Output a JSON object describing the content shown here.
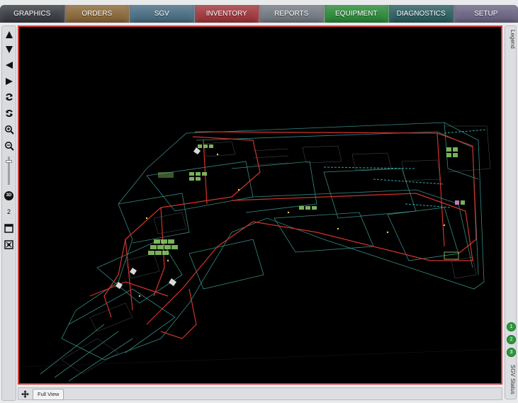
{
  "tabs": [
    {
      "label": "GRAPHICS",
      "color": "#3c3f46"
    },
    {
      "label": "ORDERS",
      "color": "#8a6a3c"
    },
    {
      "label": "SGV",
      "color": "#4d6f84"
    },
    {
      "label": "INVENTORY",
      "color": "#a13a3f"
    },
    {
      "label": "REPORTS",
      "color": "#767b84"
    },
    {
      "label": "EQUIPMENT",
      "color": "#2f8a3c"
    },
    {
      "label": "DIAGNOSTICS",
      "color": "#2f5f63"
    },
    {
      "label": "SETUP",
      "color": "#6d6784"
    }
  ],
  "toolbar": {
    "tools": [
      "pan-up-icon",
      "pan-down-icon",
      "pan-left-icon",
      "pan-right-icon",
      "rotate-cw-icon",
      "rotate-ccw-icon",
      "zoom-in-icon",
      "zoom-out-icon"
    ],
    "view_3d_label": "3D",
    "view_2d_label": "2",
    "zoom_level": 0.85
  },
  "right_panel": {
    "legend_label": "Legend",
    "status_label": "SGV Status",
    "sgv_ids": [
      "1",
      "2",
      "3"
    ],
    "status_color": "#2f9a3c"
  },
  "bottom": {
    "full_view_label": "Full View"
  },
  "viewport": {
    "border_color": "#d53a3a",
    "background": "#000000"
  }
}
